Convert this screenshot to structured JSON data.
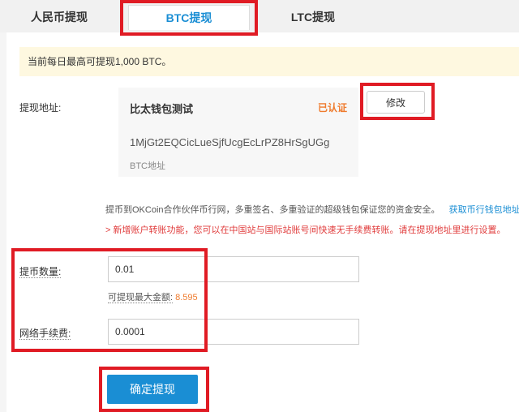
{
  "tabs": [
    {
      "label": "人民币提现"
    },
    {
      "label": "BTC提现"
    },
    {
      "label": "LTC提现"
    }
  ],
  "notice": "当前每日最高可提现1,000 BTC。",
  "address": {
    "label": "提现地址:",
    "wallet_name": "比太钱包测试",
    "status": "已认证",
    "value": "1MjGt2EQCicLueSjfUcgEcLrPZ8HrSgUGg",
    "type": "BTC地址",
    "modify_button": "修改"
  },
  "info": {
    "text": "提币到OKCoin合作伙伴币行网，多重签名、多重验证的超级钱包保证您的资金安全。",
    "link": "获取币行钱包地址"
  },
  "warning": "> 新增账户转账功能，您可以在中国站与国际站账号间快速无手续费转账。请在提现地址里进行设置。",
  "amount": {
    "label": "提币数量:",
    "value": "0.01",
    "max_label": "可提现最大金额:",
    "max_value": "8.595"
  },
  "fee": {
    "label": "网络手续费:",
    "value": "0.0001"
  },
  "confirm_button": "确定提现",
  "colors": {
    "accent": "#1a8ed4",
    "highlight_box": "#e01b24",
    "verified": "#ef7c2f",
    "warning_text": "#e03b3b",
    "notice_bg": "#fef8e0"
  }
}
